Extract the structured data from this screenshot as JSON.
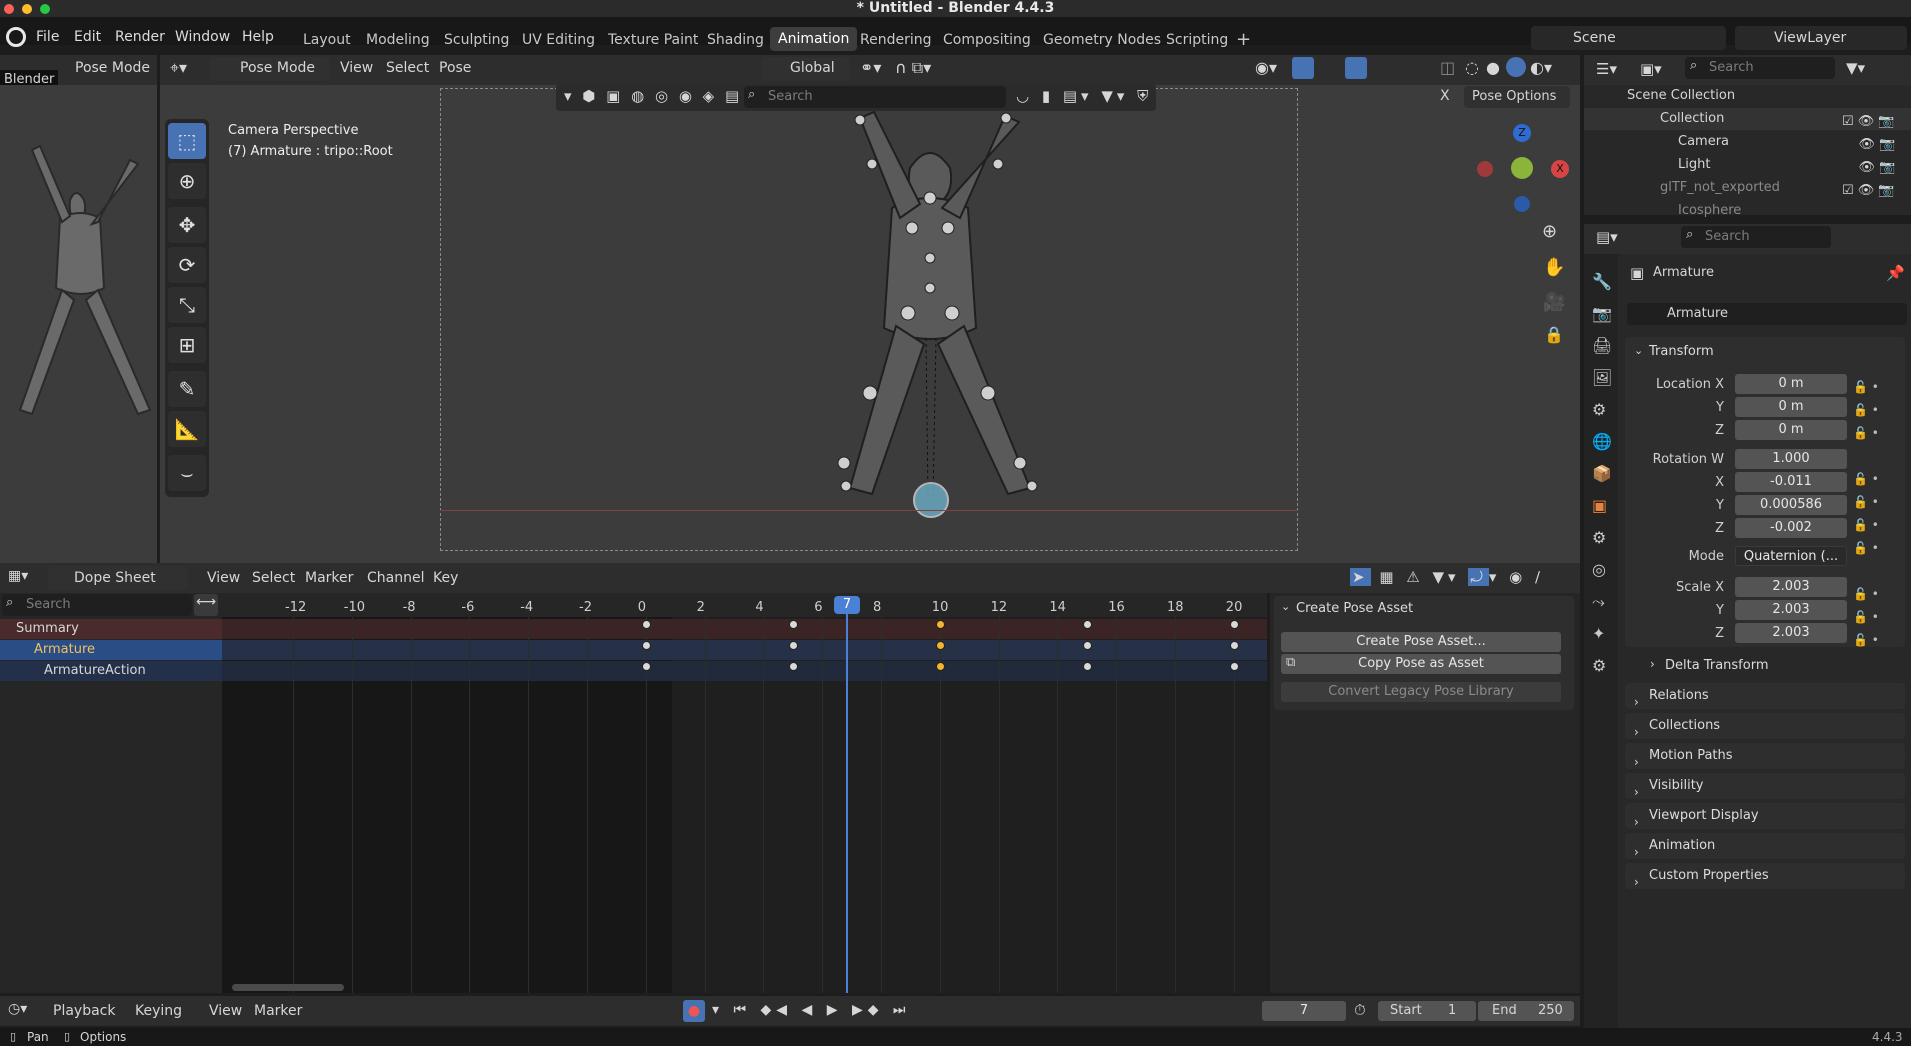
{
  "window_title": "* Untitled - Blender 4.4.3",
  "menu": [
    "File",
    "Edit",
    "Render",
    "Window",
    "Help"
  ],
  "workspaces": [
    "Layout",
    "Modeling",
    "Sculpting",
    "UV Editing",
    "Texture Paint",
    "Shading",
    "Animation",
    "Rendering",
    "Compositing",
    "Geometry Nodes",
    "Scripting"
  ],
  "active_workspace": "Animation",
  "scene": "Scene",
  "view_layer": "ViewLayer",
  "left_preview": {
    "mode": "Pose Mode",
    "tooltip": "Blender"
  },
  "viewport": {
    "mode": "Pose Mode",
    "menus": [
      "View",
      "Select",
      "Pose"
    ],
    "orientation": "Global",
    "overlay_title": "Camera Perspective",
    "overlay_sub": "(7) Armature : tripo::Root",
    "search_placeholder": "Search",
    "pose_options": "Pose Options",
    "x_label": "X"
  },
  "outliner": {
    "search_placeholder": "Search",
    "root": "Scene Collection",
    "items": [
      {
        "label": "Collection",
        "indent": 0
      },
      {
        "label": "Camera",
        "indent": 1
      },
      {
        "label": "Light",
        "indent": 1
      },
      {
        "label": "glTF_not_exported",
        "indent": 0,
        "dim": true
      },
      {
        "label": "Icosphere",
        "indent": 1,
        "dim": true
      }
    ]
  },
  "properties": {
    "search_placeholder": "Search",
    "object_label": "Armature",
    "name_field": "Armature",
    "transform_title": "Transform",
    "location": {
      "label": "Location X",
      "x": "0 m",
      "y": "0 m",
      "z": "0 m"
    },
    "rotation": {
      "label": "Rotation W",
      "w": "1.000",
      "x": "-0.011",
      "y": "0.000586",
      "z": "-0.002"
    },
    "mode_label": "Mode",
    "mode_value": "Quaternion (...",
    "scale": {
      "label": "Scale X",
      "x": "2.003",
      "y": "2.003",
      "z": "2.003"
    },
    "axis_y": "Y",
    "axis_z": "Z",
    "axis_x": "X",
    "delta": "Delta Transform",
    "sections": [
      "Relations",
      "Collections",
      "Motion Paths",
      "Visibility",
      "Viewport Display",
      "Animation",
      "Custom Properties"
    ]
  },
  "dopesheet": {
    "editor": "Dope Sheet",
    "menus": [
      "View",
      "Select",
      "Marker",
      "Channel",
      "Key"
    ],
    "search_placeholder": "Search",
    "ticks": [
      "-12",
      "-10",
      "-8",
      "-6",
      "-4",
      "-2",
      "0",
      "2",
      "4",
      "6",
      "8",
      "10",
      "12",
      "14",
      "16",
      "18",
      "20"
    ],
    "current_frame": "7",
    "channels": [
      "Summary",
      "Armature",
      "ArmatureAction"
    ],
    "keyframes": [
      0,
      5,
      10,
      15,
      20
    ],
    "selected_keyframe": 10
  },
  "pose_panel": {
    "title": "Create Pose Asset",
    "create": "Create Pose Asset...",
    "copy": "Copy Pose as Asset",
    "convert": "Convert Legacy Pose Library"
  },
  "timeline": {
    "menus": [
      "Playback",
      "Keying",
      "View",
      "Marker"
    ],
    "frame": "7",
    "start_label": "Start",
    "start": "1",
    "end_label": "End",
    "end": "250"
  },
  "status": {
    "pan": "Pan",
    "options": "Options",
    "version": "4.4.3"
  }
}
